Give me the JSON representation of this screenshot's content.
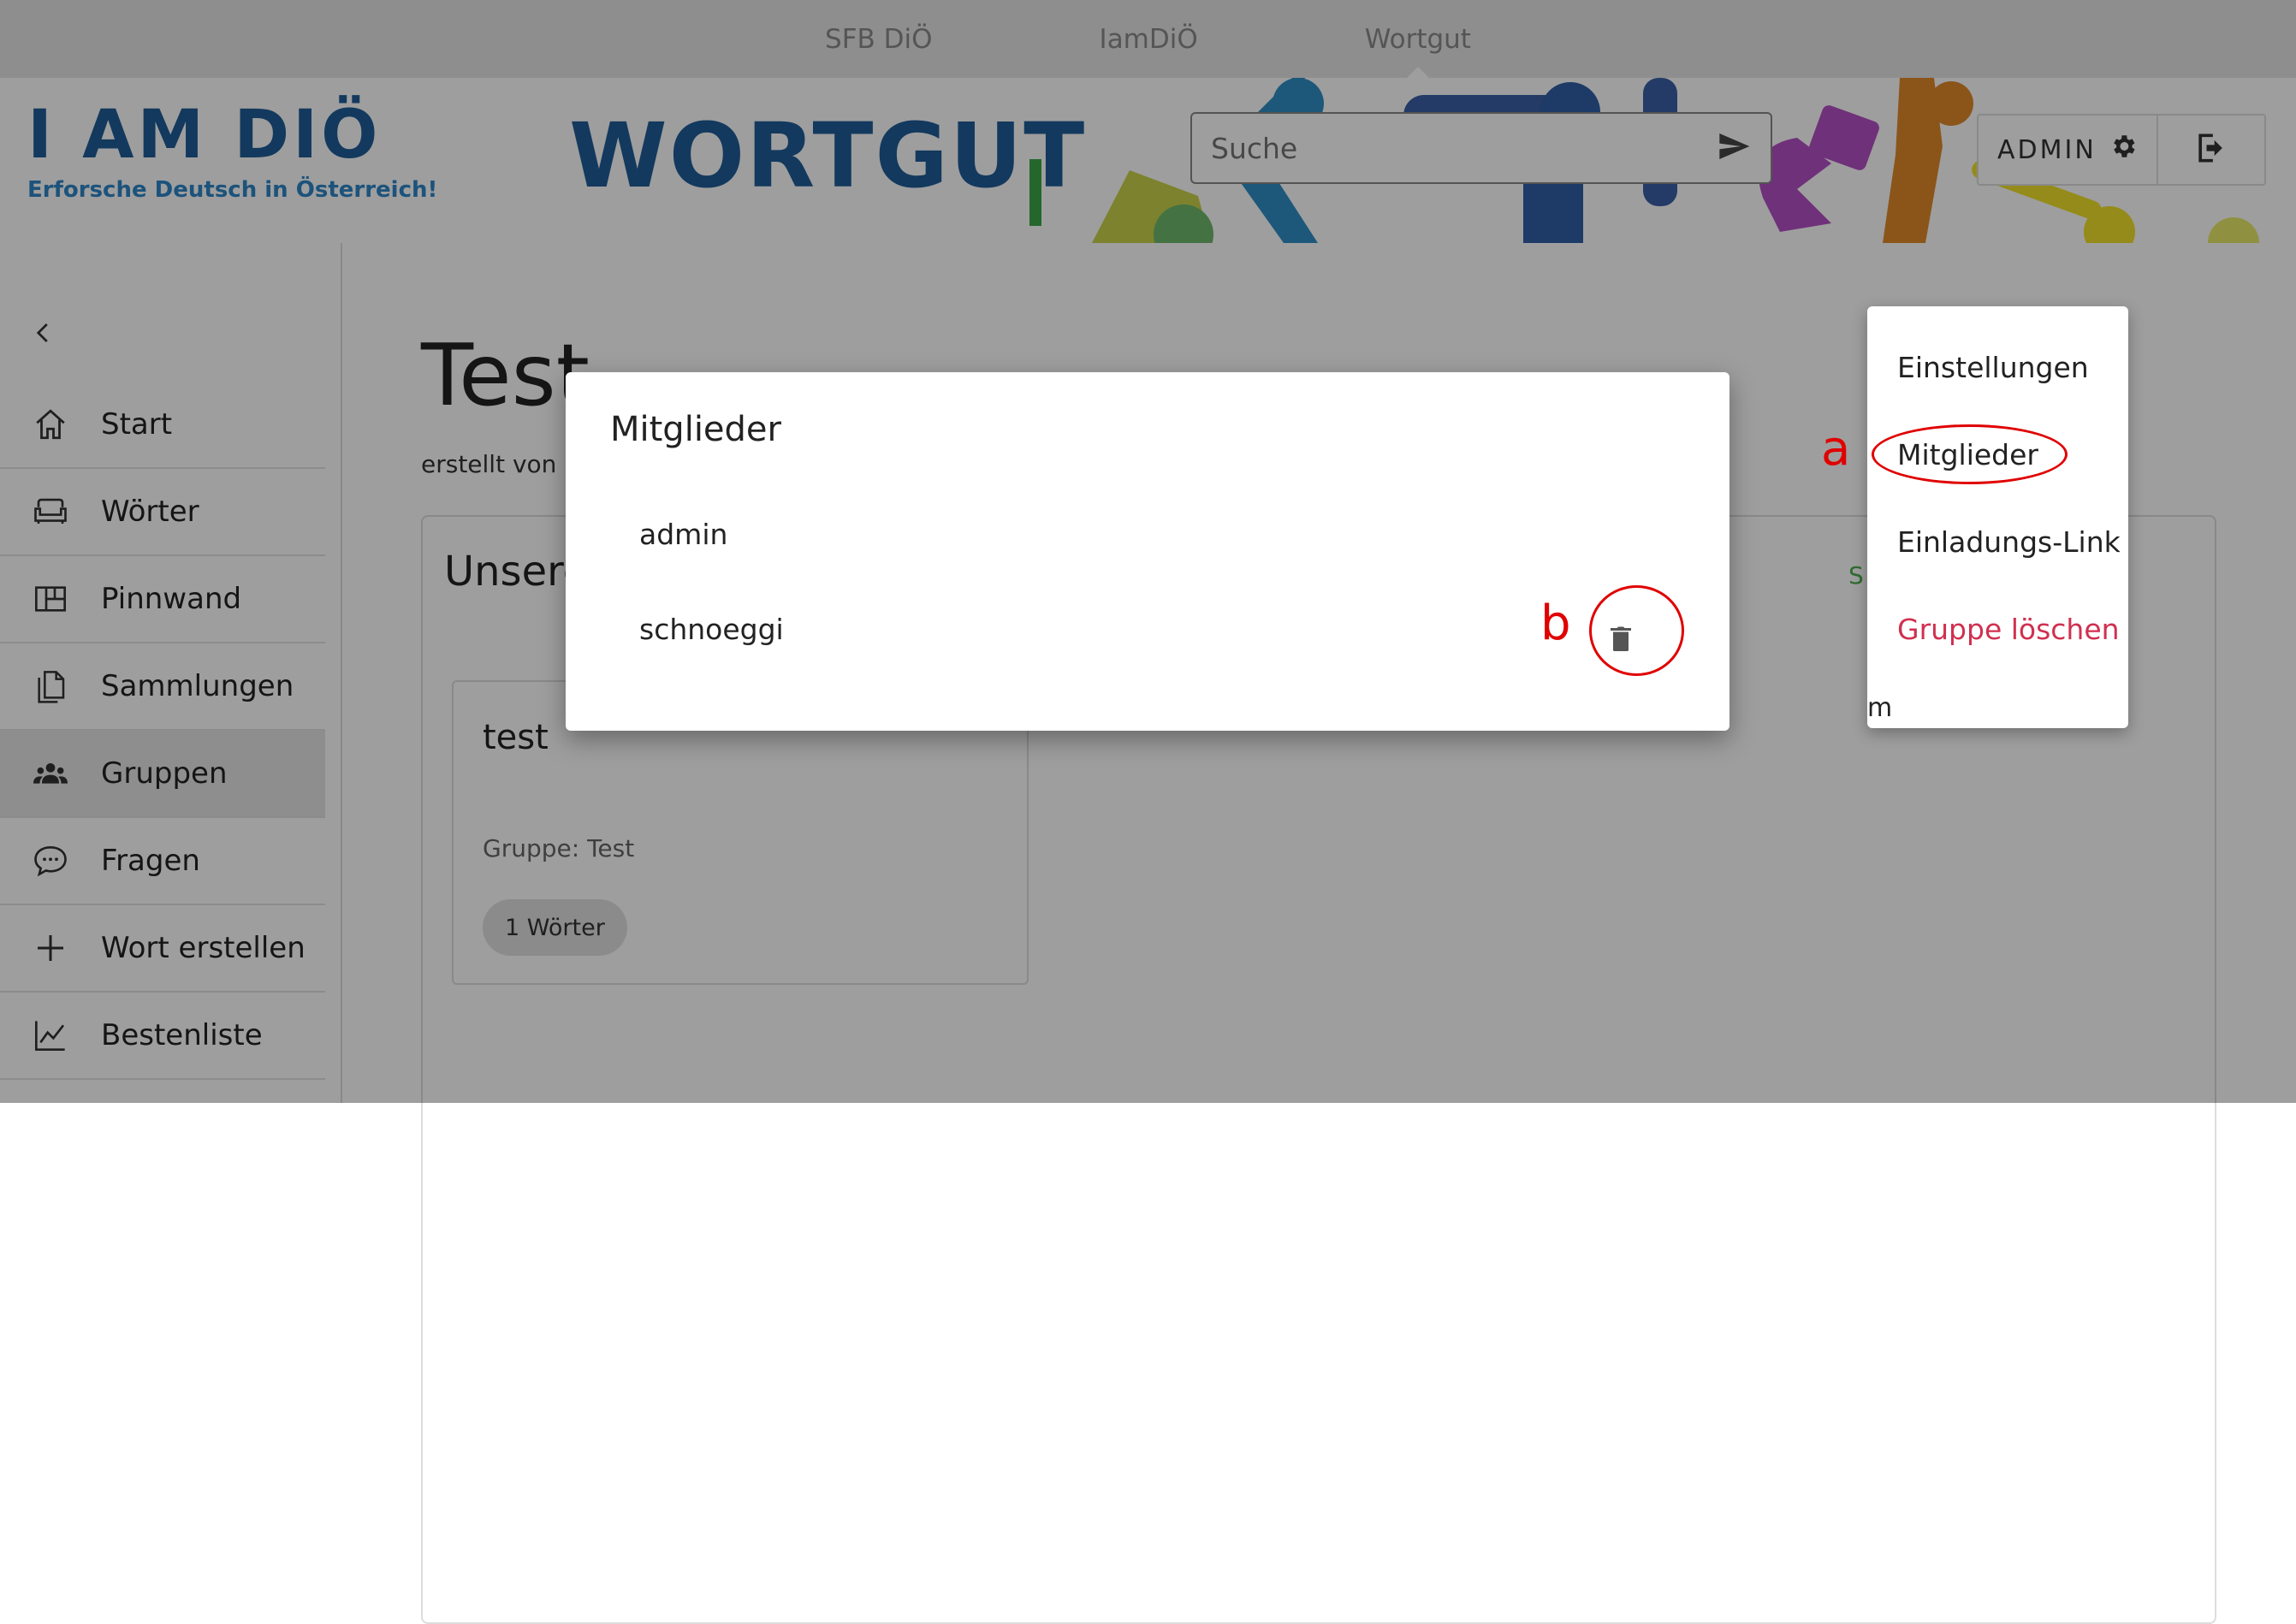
{
  "topnav": {
    "items": [
      "SFB DiÖ",
      "IamDiÖ",
      "Wortgut"
    ],
    "active": "Wortgut"
  },
  "header": {
    "logo_text": "I AM DIÖ",
    "logo_tagline": "Erforsche Deutsch in Österreich!",
    "brand_title": "WORTGUT",
    "search_placeholder": "Suche",
    "user_label": "ADMIN"
  },
  "sidebar": {
    "items": [
      {
        "label": "Start",
        "icon": "home-icon"
      },
      {
        "label": "Wörter",
        "icon": "sofa-icon"
      },
      {
        "label": "Pinnwand",
        "icon": "board-icon"
      },
      {
        "label": "Sammlungen",
        "icon": "document-icon"
      },
      {
        "label": "Gruppen",
        "icon": "group-icon",
        "active": true
      },
      {
        "label": "Fragen",
        "icon": "chat-icon"
      },
      {
        "label": "Wort erstellen",
        "icon": "plus-icon"
      },
      {
        "label": "Bestenliste",
        "icon": "chart-line-icon"
      }
    ]
  },
  "main": {
    "title": "Test",
    "created_by": "erstellt von a",
    "panel_title": "Unsere",
    "panel_action": "S.                    LEN",
    "card": {
      "title": "test",
      "group": "Gruppe: Test",
      "chip": "1 Wörter"
    }
  },
  "context_menu": {
    "items": [
      "Einstellungen",
      "Mitglieder",
      "Einladungs-Link",
      "Gruppe löschen"
    ],
    "danger_color": "#d03050",
    "tail_text": "m"
  },
  "dialog": {
    "title": "Mitglieder",
    "members": [
      "admin",
      "schnoeggi"
    ]
  },
  "annotations": {
    "a": "a",
    "b": "b",
    "color": "#e00000"
  }
}
